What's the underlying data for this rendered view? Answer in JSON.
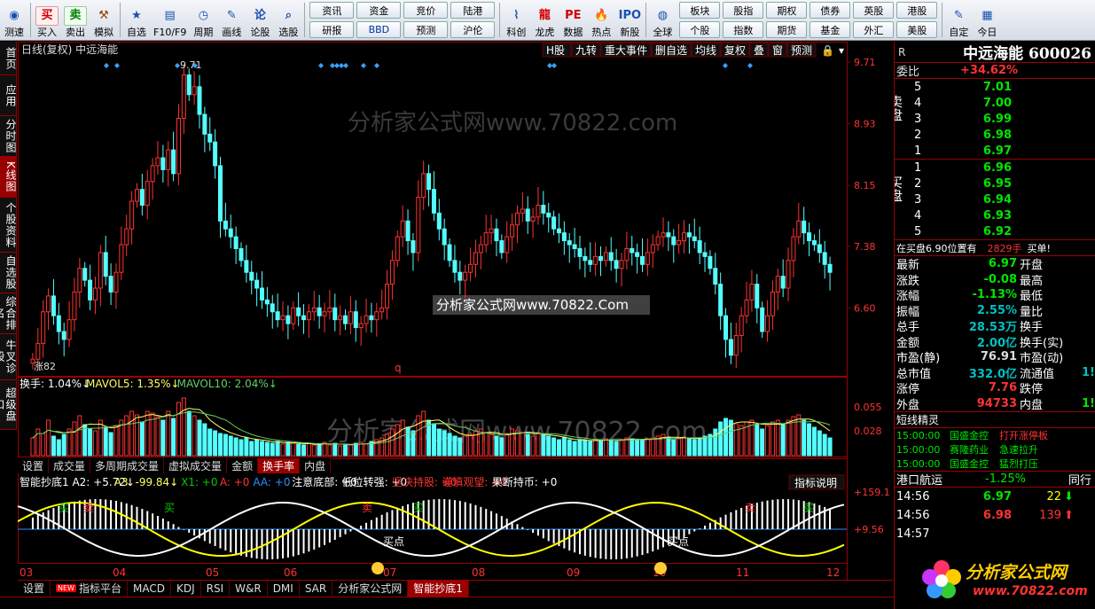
{
  "toolbar": {
    "buttons_left": [
      {
        "label": "测速",
        "icon": "speed-icon"
      },
      {
        "label": "买入",
        "icon": "buy-icon",
        "glyph": "买",
        "color": "#d00000"
      },
      {
        "label": "卖出",
        "icon": "sell-icon",
        "glyph": "卖",
        "color": "#008000"
      },
      {
        "label": "模拟",
        "icon": "gavel-icon",
        "glyph": "⚒",
        "color": "#a04000"
      },
      {
        "label": "自选",
        "icon": "star-icon",
        "glyph": "★",
        "color": "#1a50b0"
      },
      {
        "label": "F10/F9",
        "icon": "f10-icon",
        "glyph": "▤",
        "color": "#1a50b0"
      },
      {
        "label": "周期",
        "icon": "clock-icon",
        "glyph": "◷",
        "color": "#1a50b0"
      },
      {
        "label": "画线",
        "icon": "pen-icon",
        "glyph": "✎",
        "color": "#1a50b0"
      },
      {
        "label": "论股",
        "icon": "discuss-icon",
        "glyph": "论",
        "color": "#1a50b0"
      },
      {
        "label": "选股",
        "icon": "magnifier-icon",
        "glyph": "⌕",
        "color": "#1a50b0"
      }
    ],
    "grid1": [
      {
        "label": "资讯"
      },
      {
        "label": "资金"
      },
      {
        "label": "竞价"
      },
      {
        "label": "陆港"
      },
      {
        "label": "研报"
      },
      {
        "label": "BBD"
      },
      {
        "label": "预测"
      },
      {
        "label": "沪伦"
      }
    ],
    "buttons_mid": [
      {
        "label": "科创",
        "icon": "kechuang-icon",
        "glyph": "⌇",
        "color": "#1a50b0"
      },
      {
        "label": "龙虎",
        "icon": "dragon-icon",
        "glyph": "龍",
        "color": "#d00000"
      },
      {
        "label": "数据",
        "icon": "pe-icon",
        "glyph": "PE",
        "color": "#d00000"
      },
      {
        "label": "热点",
        "icon": "hot-icon",
        "glyph": "🔥",
        "color": "#d00000"
      },
      {
        "label": "新股",
        "icon": "ipo-icon",
        "glyph": "IPO",
        "color": "#1a50b0"
      },
      {
        "label": "全球",
        "icon": "globe-icon",
        "glyph": "◍",
        "color": "#1a50b0"
      }
    ],
    "grid2": [
      {
        "label": "板块"
      },
      {
        "label": "股指"
      },
      {
        "label": "期权"
      },
      {
        "label": "债券"
      },
      {
        "label": "英股"
      },
      {
        "label": "港股"
      },
      {
        "label": "个股"
      },
      {
        "label": "指数"
      },
      {
        "label": "期货"
      },
      {
        "label": "基金"
      },
      {
        "label": "外汇"
      },
      {
        "label": "美股"
      }
    ],
    "buttons_right": [
      {
        "label": "自定",
        "icon": "custom-icon",
        "glyph": "✎",
        "color": "#1a50b0"
      },
      {
        "label": "今日",
        "icon": "calendar-icon",
        "glyph": "▦",
        "color": "#1a50b0"
      }
    ]
  },
  "left_tabs": [
    {
      "label": "首页"
    },
    {
      "label": "应用"
    },
    {
      "label": "分时图"
    },
    {
      "label": "K线图",
      "active": true
    },
    {
      "label": "个股资料"
    },
    {
      "label": "自选股"
    },
    {
      "label": "综合排名"
    },
    {
      "label": "牛叉诊股"
    },
    {
      "label": "超级盘口"
    }
  ],
  "chart_header": {
    "title": "日线(复权)  中远海能",
    "buttons": [
      "H股",
      "九转",
      "重大事件",
      "删自选",
      "均线",
      "复权",
      "叠",
      "窗",
      "预测"
    ]
  },
  "chart_data": [
    {
      "type": "candlestick",
      "title": "日线(复权)  中远海能",
      "y_ticks": [
        9.71,
        8.93,
        8.15,
        7.38,
        6.6
      ],
      "ylim": [
        5.75,
        9.78
      ],
      "x_ticks": [
        "03",
        "04",
        "05",
        "06",
        "07",
        "08",
        "09",
        "10",
        "11",
        "12"
      ],
      "annotations": [
        "9.71",
        "涨82",
        "q"
      ],
      "up_color": "#ff3232",
      "down_color": "#54ffff",
      "closes": [
        5.95,
        6.15,
        6.55,
        6.75,
        6.5,
        6.3,
        6.2,
        6.45,
        6.8,
        7.1,
        6.95,
        6.7,
        6.85,
        7.3,
        7.0,
        6.8,
        7.05,
        7.4,
        7.6,
        7.95,
        8.1,
        7.9,
        8.2,
        8.4,
        8.5,
        8.35,
        8.6,
        8.3,
        9.0,
        9.55,
        9.3,
        9.4,
        9.05,
        8.8,
        8.7,
        8.4,
        7.7,
        7.6,
        7.5,
        7.35,
        7.2,
        7.05,
        6.95,
        6.85,
        6.7,
        6.65,
        6.55,
        6.45,
        6.5,
        6.4,
        6.6,
        6.5,
        6.45,
        6.55,
        6.6,
        6.5,
        6.55,
        6.6,
        6.45,
        6.5,
        6.4,
        6.55,
        6.35,
        6.4,
        6.5,
        6.45,
        6.55,
        6.6,
        6.9,
        7.2,
        7.5,
        7.7,
        7.45,
        7.3,
        8.0,
        8.3,
        8.1,
        7.8,
        7.6,
        7.4,
        7.2,
        7.05,
        6.95,
        7.05,
        7.15,
        7.3,
        7.4,
        7.55,
        7.6,
        7.45,
        7.3,
        7.5,
        7.65,
        7.8,
        7.85,
        7.7,
        7.75,
        7.9,
        7.8,
        7.75,
        7.6,
        7.55,
        7.45,
        7.4,
        7.35,
        7.25,
        7.2,
        7.15,
        7.25,
        7.2,
        7.3,
        7.2,
        7.1,
        7.2,
        7.35,
        7.3,
        7.25,
        7.15,
        7.3,
        7.4,
        7.5,
        7.55,
        7.5,
        7.4,
        7.45,
        7.55,
        7.5,
        7.45,
        7.3,
        7.25,
        7.1,
        6.9,
        6.5,
        6.2,
        6.0,
        6.25,
        6.5,
        6.7,
        6.9,
        6.6,
        6.3,
        6.5,
        6.8,
        7.0,
        6.85,
        7.2,
        7.5,
        7.7,
        7.55,
        7.45,
        7.4,
        7.3,
        7.15,
        7.05
      ]
    },
    {
      "type": "bar",
      "title": "换手率",
      "legend": [
        "换手: 1.04%↓",
        "MAVOL5: 1.35%↓",
        "MAVOL10: 2.04%↓"
      ],
      "y_ticks": [
        0.055,
        0.028
      ],
      "ylim": [
        0,
        0.072
      ],
      "values": [
        0.02,
        0.03,
        0.025,
        0.04,
        0.022,
        0.018,
        0.024,
        0.03,
        0.038,
        0.045,
        0.035,
        0.03,
        0.028,
        0.04,
        0.032,
        0.026,
        0.034,
        0.04,
        0.045,
        0.05,
        0.046,
        0.038,
        0.05,
        0.048,
        0.044,
        0.04,
        0.05,
        0.042,
        0.06,
        0.065,
        0.05,
        0.045,
        0.04,
        0.036,
        0.03,
        0.028,
        0.025,
        0.024,
        0.022,
        0.02,
        0.018,
        0.02,
        0.016,
        0.018,
        0.016,
        0.015,
        0.014,
        0.016,
        0.013,
        0.015,
        0.014,
        0.013,
        0.012,
        0.014,
        0.012,
        0.013,
        0.015,
        0.012,
        0.014,
        0.011,
        0.013,
        0.012,
        0.014,
        0.015,
        0.013,
        0.016,
        0.018,
        0.02,
        0.024,
        0.03,
        0.035,
        0.04,
        0.032,
        0.028,
        0.045,
        0.05,
        0.04,
        0.036,
        0.03,
        0.028,
        0.025,
        0.022,
        0.02,
        0.022,
        0.024,
        0.028,
        0.03,
        0.026,
        0.024,
        0.022,
        0.02,
        0.025,
        0.03,
        0.028,
        0.026,
        0.024,
        0.022,
        0.026,
        0.024,
        0.022,
        0.02,
        0.018,
        0.02,
        0.018,
        0.016,
        0.018,
        0.017,
        0.016,
        0.018,
        0.017,
        0.019,
        0.018,
        0.016,
        0.018,
        0.02,
        0.019,
        0.018,
        0.017,
        0.019,
        0.02,
        0.022,
        0.024,
        0.02,
        0.018,
        0.019,
        0.021,
        0.02,
        0.018,
        0.02,
        0.022,
        0.024,
        0.03,
        0.038,
        0.042,
        0.04,
        0.036,
        0.034,
        0.038,
        0.04,
        0.035,
        0.03,
        0.034,
        0.038,
        0.04,
        0.036,
        0.04,
        0.044,
        0.046,
        0.04,
        0.036,
        0.032,
        0.028,
        0.024,
        0.02
      ]
    },
    {
      "type": "line",
      "title": "智能抄底1",
      "legend": [
        "智能抄底1 A2: +5.72↓",
        "A3: -99.84↓",
        "X1: +0",
        "A: +0",
        "AA: +0",
        "注意底部: +0",
        "低位转强: +0",
        "坚决持股: +0",
        "谨慎观望: +0",
        "果断持币: +0"
      ],
      "y_ticks": [
        "+159.1",
        "+9.56"
      ],
      "labels": [
        "买点",
        "买点",
        "买",
        "卖",
        "买",
        "卖",
        "买",
        "卖",
        "买"
      ],
      "series": [
        {
          "name": "A2"
        },
        {
          "name": "A3"
        }
      ]
    }
  ],
  "sub_tabs": [
    {
      "label": "设置"
    },
    {
      "label": "成交量"
    },
    {
      "label": "多周期成交量"
    },
    {
      "label": "虚拟成交量"
    },
    {
      "label": "金额"
    },
    {
      "label": "换手率",
      "active": true
    },
    {
      "label": "内盘"
    }
  ],
  "indicator_help": "指标说明",
  "bottom_tabs": [
    {
      "label": "设置"
    },
    {
      "label": "NEW 指标平台",
      "badge": "NEW"
    },
    {
      "label": "MACD"
    },
    {
      "label": "KDJ"
    },
    {
      "label": "RSI"
    },
    {
      "label": "W&R"
    },
    {
      "label": "DMI"
    },
    {
      "label": "SAR"
    },
    {
      "label": "分析家公式网"
    },
    {
      "label": "智能抄底1",
      "active": true
    }
  ],
  "watermarks": [
    "分析家公式网www.70822.com",
    "分析家公式网www.70822.Com",
    "分析家公式网www.70822.com"
  ],
  "quote": {
    "r_label": "R",
    "name": "中远海能",
    "code": "600026",
    "weibi_label": "委比",
    "weibi": "+34.62%",
    "sell_label": "卖盘",
    "buy_label": "买盘",
    "asks": [
      {
        "n": "5",
        "p": "7.01"
      },
      {
        "n": "4",
        "p": "7.00"
      },
      {
        "n": "3",
        "p": "6.99"
      },
      {
        "n": "2",
        "p": "6.98"
      },
      {
        "n": "1",
        "p": "6.97"
      }
    ],
    "bids": [
      {
        "n": "1",
        "p": "6.96"
      },
      {
        "n": "2",
        "p": "6.95"
      },
      {
        "n": "3",
        "p": "6.94"
      },
      {
        "n": "4",
        "p": "6.93"
      },
      {
        "n": "5",
        "p": "6.92"
      }
    ],
    "notice": "在买盘6.90位置有",
    "notice_vol": "2829手",
    "notice_tail": "买单!",
    "stats": [
      {
        "k1": "最新",
        "v1": "6.97",
        "c1": "grn",
        "k2": "开盘"
      },
      {
        "k1": "涨跌",
        "v1": "-0.08",
        "c1": "grn",
        "k2": "最高"
      },
      {
        "k1": "涨幅",
        "v1": "-1.13%",
        "c1": "grn",
        "k2": "最低"
      },
      {
        "k1": "振幅",
        "v1": "2.55%",
        "c1": "cy",
        "k2": "量比"
      },
      {
        "k1": "总手",
        "v1": "28.53万",
        "c1": "cy",
        "k2": "换手"
      },
      {
        "k1": "金额",
        "v1": "2.00亿",
        "c1": "cy",
        "k2": "换手(实)"
      },
      {
        "k1": "市盈(静)",
        "v1": "76.91",
        "c1": "wht",
        "k2": "市盈(动)"
      },
      {
        "k1": "总市值",
        "v1": "332.0亿",
        "c1": "cy",
        "k2": "流通值",
        "v2": "1!",
        "c2": "cy"
      },
      {
        "k1": "涨停",
        "v1": "7.76",
        "c1": "red",
        "k2": "跌停"
      },
      {
        "k1": "外盘",
        "v1": "94733",
        "c1": "red",
        "k2": "内盘",
        "v2": "1!",
        "c2": "grn"
      }
    ],
    "short_title": "短线精灵",
    "short_list": [
      {
        "t": "15:00:00",
        "n": "国盛金控",
        "e": "打开涨停板"
      },
      {
        "t": "15:00:00",
        "n": "赛隆药业",
        "e": "急速拉升"
      },
      {
        "t": "15:00:00",
        "n": "国盛金控",
        "e": "猛烈打压"
      }
    ],
    "ticker_title": "港口航运",
    "ticker_pct": "-1.25%",
    "ticker_tail": "同行",
    "ticks": [
      {
        "t": "14:56",
        "p": "6.97",
        "v": "22",
        "dir": "down"
      },
      {
        "t": "14:56",
        "p": "6.98",
        "v": "139",
        "dir": "up"
      },
      {
        "t": "14:57",
        "p": "",
        "v": ""
      }
    ],
    "logo_text": "分析家公式网",
    "logo_url": "www.70822.com"
  }
}
